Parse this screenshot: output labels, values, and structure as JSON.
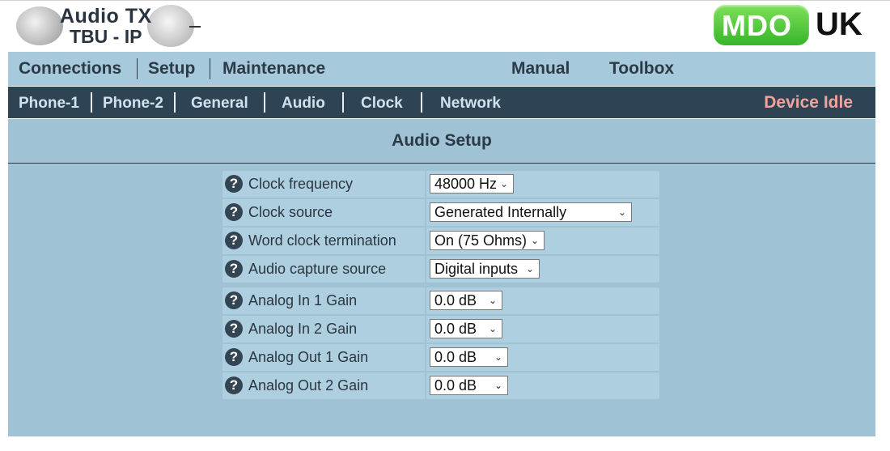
{
  "logo": {
    "line1": "Audio TX",
    "line2": "TBU - IP",
    "brand_badge": "MDO",
    "brand_suffix": "UK"
  },
  "main_nav": {
    "connections": "Connections",
    "setup": "Setup",
    "maintenance": "Maintenance",
    "manual": "Manual",
    "toolbox": "Toolbox"
  },
  "sub_nav": {
    "phone1": "Phone-1",
    "phone2": "Phone-2",
    "general": "General",
    "audio": "Audio",
    "clock": "Clock",
    "network": "Network",
    "status": "Device Idle"
  },
  "page": {
    "title": "Audio Setup"
  },
  "settings": [
    {
      "label": "Clock frequency",
      "value": "48000 Hz"
    },
    {
      "label": "Clock source",
      "value": "Generated Internally"
    },
    {
      "label": "Word clock termination",
      "value": "On (75 Ohms)"
    },
    {
      "label": "Audio capture source",
      "value": "Digital inputs"
    },
    {
      "label": "Analog In 1 Gain",
      "value": "0.0 dB"
    },
    {
      "label": "Analog In 2 Gain",
      "value": "0.0 dB"
    },
    {
      "label": "Analog Out 1 Gain",
      "value": "0.0 dB"
    },
    {
      "label": "Analog Out 2 Gain",
      "value": "0.0 dB"
    }
  ],
  "icons": {
    "help": "question-circle-icon",
    "dropdown": "chevron-down-icon"
  },
  "colors": {
    "main_nav_bg": "#a6c9dc",
    "sub_nav_bg": "#2e4455",
    "status_color": "#f0a39a",
    "content_bg": "#9fc2d4",
    "brand_green": "#37b52a"
  }
}
